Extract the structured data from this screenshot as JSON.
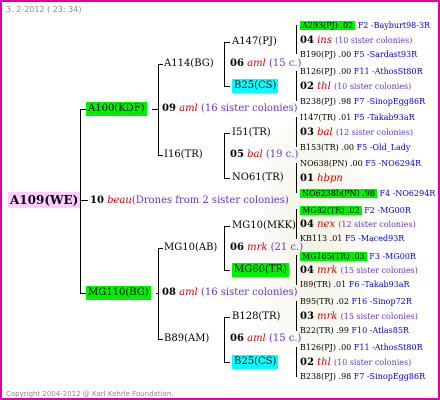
{
  "header": {
    "date": "3. 2-2012 ( 23: 34)"
  },
  "copyright": "Copyright 2004-2012 @ Karl Kehrle Foundation.",
  "root": {
    "id": "A109(WE)",
    "num": "10",
    "breeder": "beau",
    "note": "(Drones from 2 sister colonies)"
  },
  "g1": [
    {
      "id": "A100(KDF)",
      "num": "09",
      "breeder": "aml",
      "note": "(16 sister colonies)"
    },
    {
      "id": "MG110(BG)",
      "num": "08",
      "breeder": "aml",
      "note": "(16 sister colonies)"
    }
  ],
  "g2": [
    {
      "id": "A114(BG)",
      "num": "06",
      "breeder": "aml",
      "note": "(15 c.)"
    },
    {
      "id": "I16(TR)",
      "num": "05",
      "breeder": "bal",
      "note": "(19 c.)"
    },
    {
      "id": "MG10(AB)",
      "num": "06",
      "breeder": "mrk",
      "note": "(21 c.)"
    },
    {
      "id": "B89(AM)",
      "num": "06",
      "breeder": "aml",
      "note": "(15 c.)"
    }
  ],
  "g3": [
    "A147(PJ)",
    "B25(CS)",
    "I51(TR)",
    "NO61(TR)",
    "MG10(MKK)",
    "MG60(TR)",
    "B128(TR)",
    "B25(CS)"
  ],
  "g4": [
    {
      "top": [
        "A293(PJ) .02",
        "F2 -Bayburt98-3R"
      ],
      "num": "04",
      "breeder": "ins",
      "note": "(10 sister colonies)",
      "bot": [
        "B190(PJ) .00",
        "F5 -Sardast93R"
      ]
    },
    {
      "top": [
        "B126(PJ) .00",
        "F11 -AthosSt80R"
      ],
      "num": "02",
      "breeder": "thl",
      "note": "(10 sister colonies)",
      "bot": [
        "B238(PJ) .98",
        "F7 -SinopEgg86R"
      ]
    },
    {
      "top": [
        "I147(TR) .01",
        "F5 -Takab93aR"
      ],
      "num": "03",
      "breeder": "bal",
      "note": "(12 sister colonies)",
      "bot": [
        "B153(TR) .00",
        "F5 -Old_Lady"
      ]
    },
    {
      "top": [
        "NO638(PN) .00",
        "F5 -NO6294R"
      ],
      "num": "01",
      "breeder": "hbpn",
      "note": "",
      "bot": [
        "NO6238b(PN) .98",
        "F4 -NO6294R"
      ]
    },
    {
      "top": [
        "MG82(TR) .02",
        "F2 -MG00R"
      ],
      "num": "04",
      "breeder": "nex",
      "note": "(12 sister colonies)",
      "bot": [
        "KB113 .01",
        "F5 -Maced93R"
      ]
    },
    {
      "top": [
        "MG165(TR) .03",
        "F3 -MG00R"
      ],
      "num": "04",
      "breeder": "mrk",
      "note": "(15 sister colonies)",
      "bot": [
        "I89(TR) .01",
        "F6 -Takab93aR"
      ]
    },
    {
      "top": [
        "B95(TR) .02",
        "F16 -Sinop72R"
      ],
      "num": "03",
      "breeder": "mrk",
      "note": "(15 sister colonies)",
      "bot": [
        "B22(TR) .99",
        "F10 -Atlas85R"
      ]
    },
    {
      "top": [
        "B126(PJ) .00",
        "F11 -AthosSt80R"
      ],
      "num": "02",
      "breeder": "thl",
      "note": "(10 sister colonies)",
      "bot": [
        "B238(PJ) .98",
        "F7 -SinopEgg86R"
      ]
    }
  ]
}
